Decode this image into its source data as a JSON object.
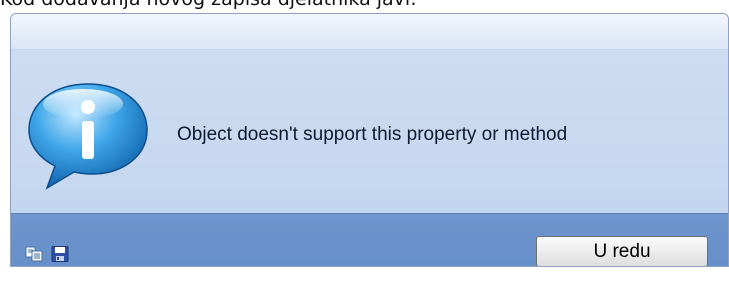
{
  "page": {
    "top_text": "Kod dodavanja novog zapisa djelatnika javi:"
  },
  "dialog": {
    "message": "Object doesn't support this property or method",
    "ok_label": "U redu",
    "icon": "info-bubble-icon"
  },
  "footer": {
    "icons": [
      "copy-icon",
      "save-icon"
    ]
  },
  "colors": {
    "content_bg": "#c8d9f0",
    "footer_bg": "#6a93ca",
    "titlebar_bg": "#e6eef9"
  }
}
